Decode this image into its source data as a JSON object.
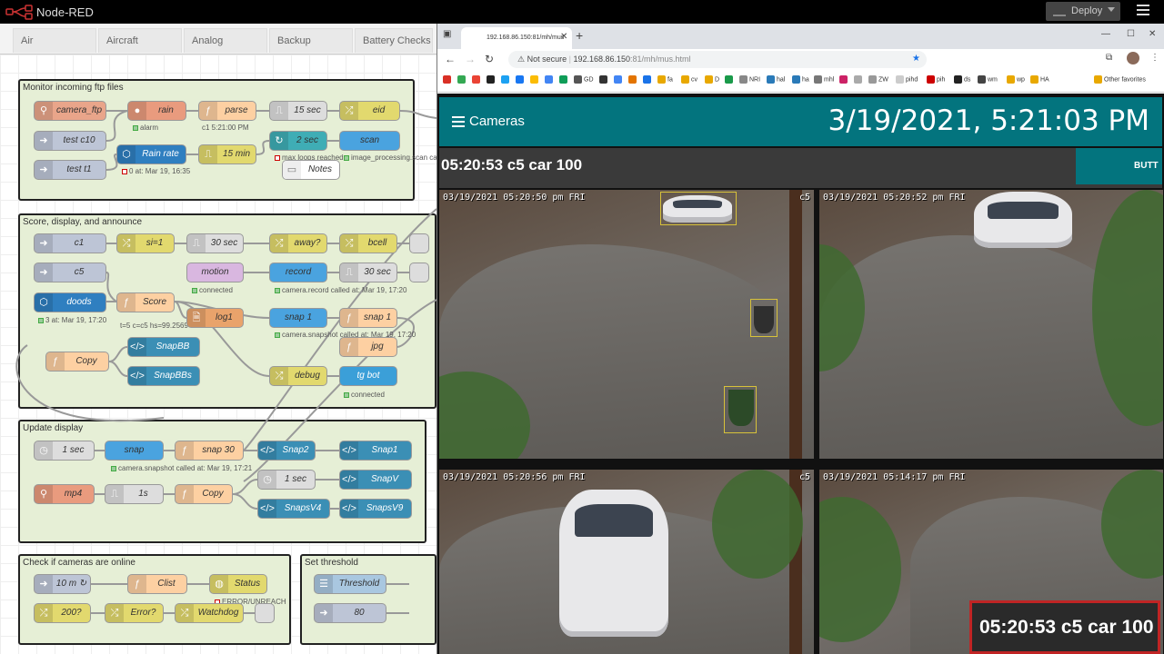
{
  "app": {
    "title": "Node-RED",
    "deploy_label": "Deploy"
  },
  "tabs": [
    "Air",
    "Aircraft",
    "Analog",
    "Backup",
    "Battery Checks"
  ],
  "groups": {
    "g1": "Monitor incoming ftp files",
    "g2": "Score, display, and announce",
    "g3": "Update display",
    "g4": "Check if cameras are online",
    "g5": "Set threshold"
  },
  "nodes": {
    "camera_ftp": "camera_ftp",
    "test_c10": "test c10",
    "test_t1": "test t1",
    "rain": "rain",
    "rain_rate": "Rain rate",
    "parse": "parse",
    "min15": "15 min",
    "sec15": "15 sec",
    "sec2": "2 sec",
    "notes": "Notes",
    "eid": "eid",
    "scan": "scan",
    "c1": "c1",
    "c5": "c5",
    "doods": "doods",
    "si1": "si=1",
    "score": "Score",
    "copy1": "Copy",
    "sec30": "30 sec",
    "motion": "motion",
    "log1": "log1",
    "snapbb": "SnapBB",
    "snapbbs": "SnapBBs",
    "away": "away?",
    "record": "record",
    "snap1a": "snap 1",
    "debug": "debug",
    "bcell": "bcell",
    "sec30b": "30 sec",
    "snap1b": "snap 1",
    "jpg": "jpg",
    "tgbot": "tg bot",
    "sec1": "1 sec",
    "snap": "snap",
    "snap30": "snap 30",
    "snap2": "Snap2",
    "snap1c": "Snap1",
    "mp4": "mp4",
    "s1": "1s",
    "copy2": "Copy",
    "sec1b": "1 sec",
    "snapv": "SnapV",
    "snapsv4": "SnapsV4",
    "snapsv9": "SnapsV9",
    "min10": "10 m ↻",
    "clist": "Clist",
    "status": "Status",
    "q200": "200?",
    "error": "Error?",
    "watchdog": "Watchdog",
    "threshold": "Threshold",
    "v80": "80"
  },
  "statuses": {
    "rain": "alarm",
    "parse": "c1 5:21:00 PM",
    "rain_rate": "0 at: Mar 19, 16:35",
    "sec2": "max loops reached",
    "scan": "image_processing.scan ca",
    "motion": "connected",
    "record": "camera.record called at: Mar 19, 17:20",
    "doods": "3 at: Mar 19, 17:20",
    "score": "t=5 c=c5 hs=99.2569",
    "snap1a": "camera.snapshot called at: Mar 19, 17:20",
    "tgbot": "connected",
    "snap": "camera.snapshot called at: Mar 19, 17:21",
    "status": "ERROR/UNREACH"
  },
  "browser": {
    "tab_title": "192.168.86.150:81/mh/mus",
    "not_secure": "Not secure",
    "url_host": "192.168.86.150",
    "url_rest": ":81/mh/mus.html",
    "bookmarks": [
      "GD",
      "fa",
      "cv",
      "D",
      "NRI",
      "hal",
      "ha",
      "mhl",
      "ZW",
      "pihd",
      "pih",
      "ds",
      "wm",
      "wp",
      "HA"
    ],
    "other_bookmarks": "Other favorites"
  },
  "ha": {
    "title": "Cameras",
    "clock": "3/19/2021, 5:21:03 PM",
    "detection": "05:20:53 c5 car 100",
    "button": "BUTT",
    "toast": "05:20:53 c5 car 100",
    "cams": [
      {
        "ts": "03/19/2021 05:20:50 pm FRI",
        "name": "c5"
      },
      {
        "ts": "03/19/2021 05:20:52 pm FRI",
        "name": ""
      },
      {
        "ts": "03/19/2021 05:20:56 pm FRI",
        "name": "c5"
      },
      {
        "ts": "03/19/2021 05:14:17 pm FRI",
        "name": ""
      }
    ]
  },
  "colors": {
    "header": "#000000",
    "ha_teal": "#03747e",
    "group_fill": "#e6efd6",
    "toast_border": "#c02424"
  }
}
